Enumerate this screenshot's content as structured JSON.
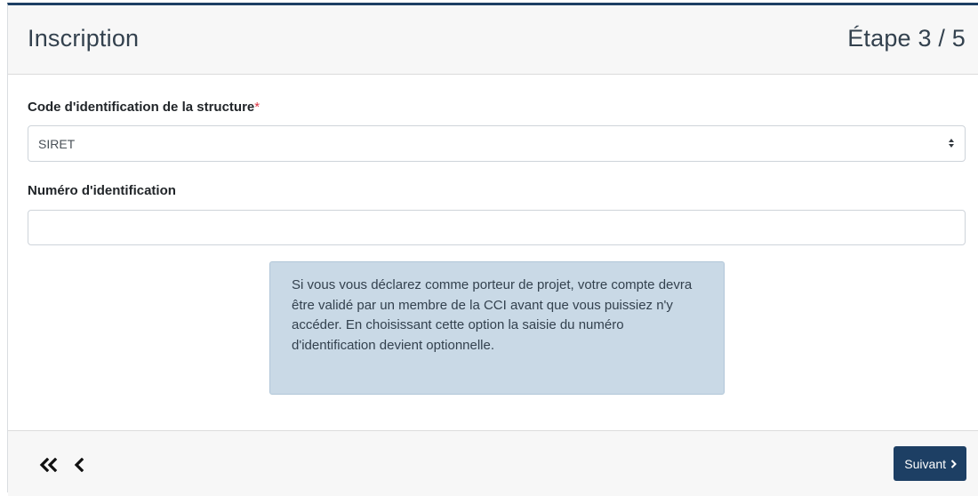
{
  "header": {
    "title": "Inscription",
    "step": "Étape 3 / 5"
  },
  "form": {
    "structure_code": {
      "label": "Code d'identification de la structure",
      "required_mark": "*",
      "selected": "SIRET"
    },
    "identification_number": {
      "label": "Numéro d'identification",
      "value": "",
      "placeholder": ""
    }
  },
  "info": {
    "text": "Si vous vous déclarez comme porteur de projet, votre compte devra être validé par un membre de la CCI avant que vous puissiez n'y accéder. En choisissant cette option la saisie du numéro d'identification devient optionnelle."
  },
  "footer": {
    "next_label": "Suivant",
    "icons": [
      "double-chevron-left-icon",
      "chevron-left-icon",
      "chevron-right-icon"
    ]
  },
  "colors": {
    "primary": "#1d3f64",
    "info_background": "#c9d9e6",
    "required": "#dc3545"
  }
}
